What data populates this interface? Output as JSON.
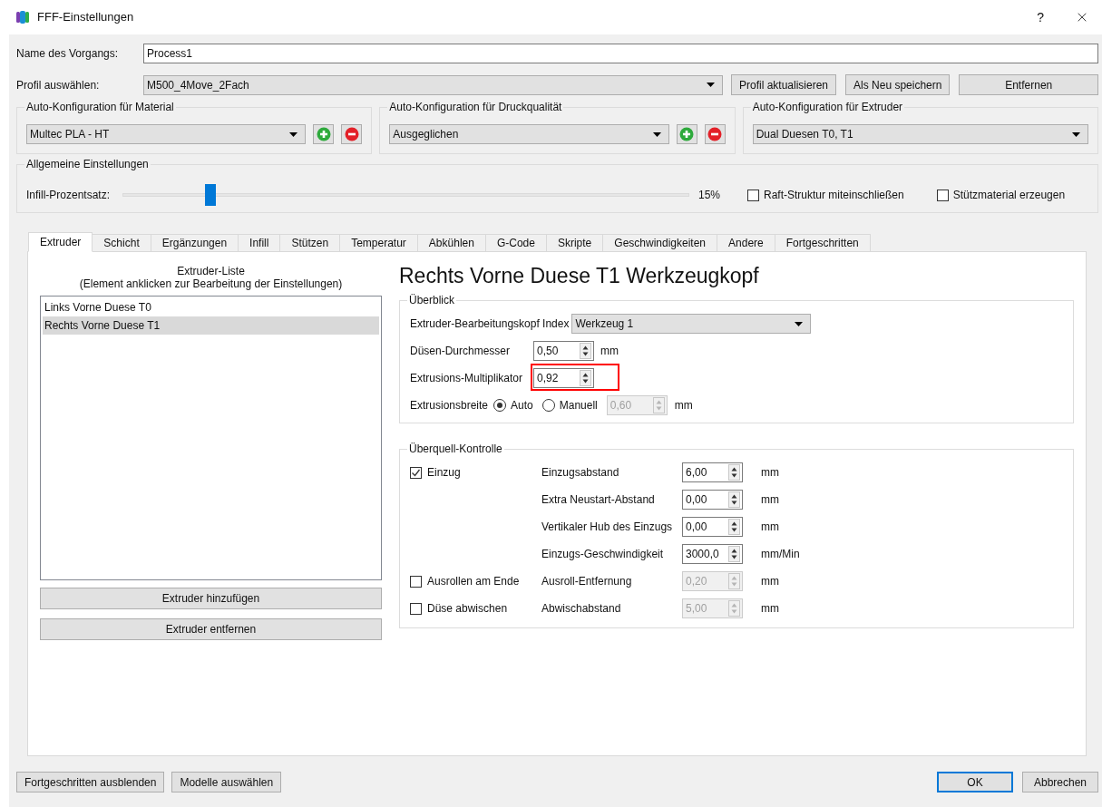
{
  "window": {
    "title": "FFF-Einstellungen",
    "help": "?"
  },
  "process_name": {
    "label": "Name des Vorgangs:",
    "value": "Process1"
  },
  "profile": {
    "label": "Profil auswählen:",
    "value": "M500_4Move_2Fach",
    "buttons": [
      "Profil aktualisieren",
      "Als Neu speichern",
      "Entfernen"
    ]
  },
  "auto_config": [
    {
      "kind": "editable",
      "title": "Auto-Konfiguration für Material",
      "value": "Multec PLA - HT"
    },
    {
      "kind": "editable",
      "title": "Auto-Konfiguration für Druckqualität",
      "value": "Ausgeglichen"
    },
    {
      "kind": "fixed",
      "title": "Auto-Konfiguration für Extruder",
      "value": "Dual Duesen T0, T1"
    }
  ],
  "general": {
    "title": "Allgemeine Einstellungen",
    "infill_label": "Infill-Prozentsatz:",
    "level": 0.155,
    "reading": "15%",
    "checkboxes": [
      {
        "label": "Raft-Struktur miteinschließen",
        "checked": false
      },
      {
        "label": "Stützmaterial erzeugen",
        "checked": false
      }
    ]
  },
  "tabs": [
    {
      "label": "Extruder",
      "selected": true
    },
    {
      "label": "Schicht",
      "selected": false
    },
    {
      "label": "Ergänzungen",
      "selected": false
    },
    {
      "label": "Infill",
      "selected": false
    },
    {
      "label": "Stützen",
      "selected": false
    },
    {
      "label": "Temperatur",
      "selected": false
    },
    {
      "label": "Abkühlen",
      "selected": false
    },
    {
      "label": "G-Code",
      "selected": false
    },
    {
      "label": "Skripte",
      "selected": false
    },
    {
      "label": "Geschwindigkeiten",
      "selected": false
    },
    {
      "label": "Andere",
      "selected": false
    },
    {
      "label": "Fortgeschritten",
      "selected": false
    }
  ],
  "extruder_list": {
    "title": "Extruder-Liste",
    "subtitle": "(Element anklicken zur Bearbeitung der Einstellungen)",
    "items": [
      {
        "label": "Links Vorne Duese T0",
        "selected": false
      },
      {
        "label": "Rechts Vorne Duese T1",
        "selected": true
      }
    ],
    "buttons": [
      "Extruder hinzufügen",
      "Extruder entfernen"
    ]
  },
  "heading": "Rechts Vorne Duese T1 Werkzeugkopf",
  "overview": {
    "title": "Überblick",
    "rows": [
      {
        "kind": "select",
        "label": "Extruder-Bearbeitungskopf Index",
        "value": "Werkzeug 1"
      },
      {
        "kind": "spin",
        "label": "Düsen-Durchmesser",
        "value": "0,50",
        "unit": "mm",
        "highlighted": false
      },
      {
        "kind": "spin",
        "label": "Extrusions-Multiplikator",
        "value": "0,92",
        "highlighted": true
      },
      {
        "kind": "radio",
        "label": "Extrusionsbreite",
        "options": [
          {
            "label": "Auto",
            "selected": true
          },
          {
            "label": "Manuell",
            "selected": false
          }
        ],
        "value": "0,60",
        "unit": "mm",
        "disabled": true
      }
    ]
  },
  "ooze": {
    "title": "Überquell-Kontrolle",
    "rows": [
      {
        "toggle": {
          "label": "Einzug",
          "checked": true
        },
        "label": "Einzugsabstand",
        "value": "6,00",
        "unit": "mm",
        "disabled": false
      },
      {
        "label": "Extra Neustart-Abstand",
        "value": "0,00",
        "unit": "mm",
        "disabled": false
      },
      {
        "label": "Vertikaler Hub des Einzugs",
        "value": "0,00",
        "unit": "mm",
        "disabled": false
      },
      {
        "label": "Einzugs-Geschwindigkeit",
        "value": "3000,0",
        "unit": "mm/Min",
        "disabled": false
      },
      {
        "toggle": {
          "label": "Ausrollen am Ende",
          "checked": false
        },
        "label": "Ausroll-Entfernung",
        "value": "0,20",
        "unit": "mm",
        "disabled": true
      },
      {
        "toggle": {
          "label": "Düse abwischen",
          "checked": false
        },
        "label": "Abwischabstand",
        "value": "5,00",
        "unit": "mm",
        "disabled": true
      }
    ]
  },
  "footer": {
    "left_buttons": [
      {
        "label": "Fortgeschritten ausblenden",
        "default": false
      },
      {
        "label": "Modelle auswählen",
        "default": false
      }
    ],
    "right_buttons": [
      {
        "label": "OK",
        "default": true
      },
      {
        "label": "Abbrechen",
        "default": false
      }
    ]
  }
}
